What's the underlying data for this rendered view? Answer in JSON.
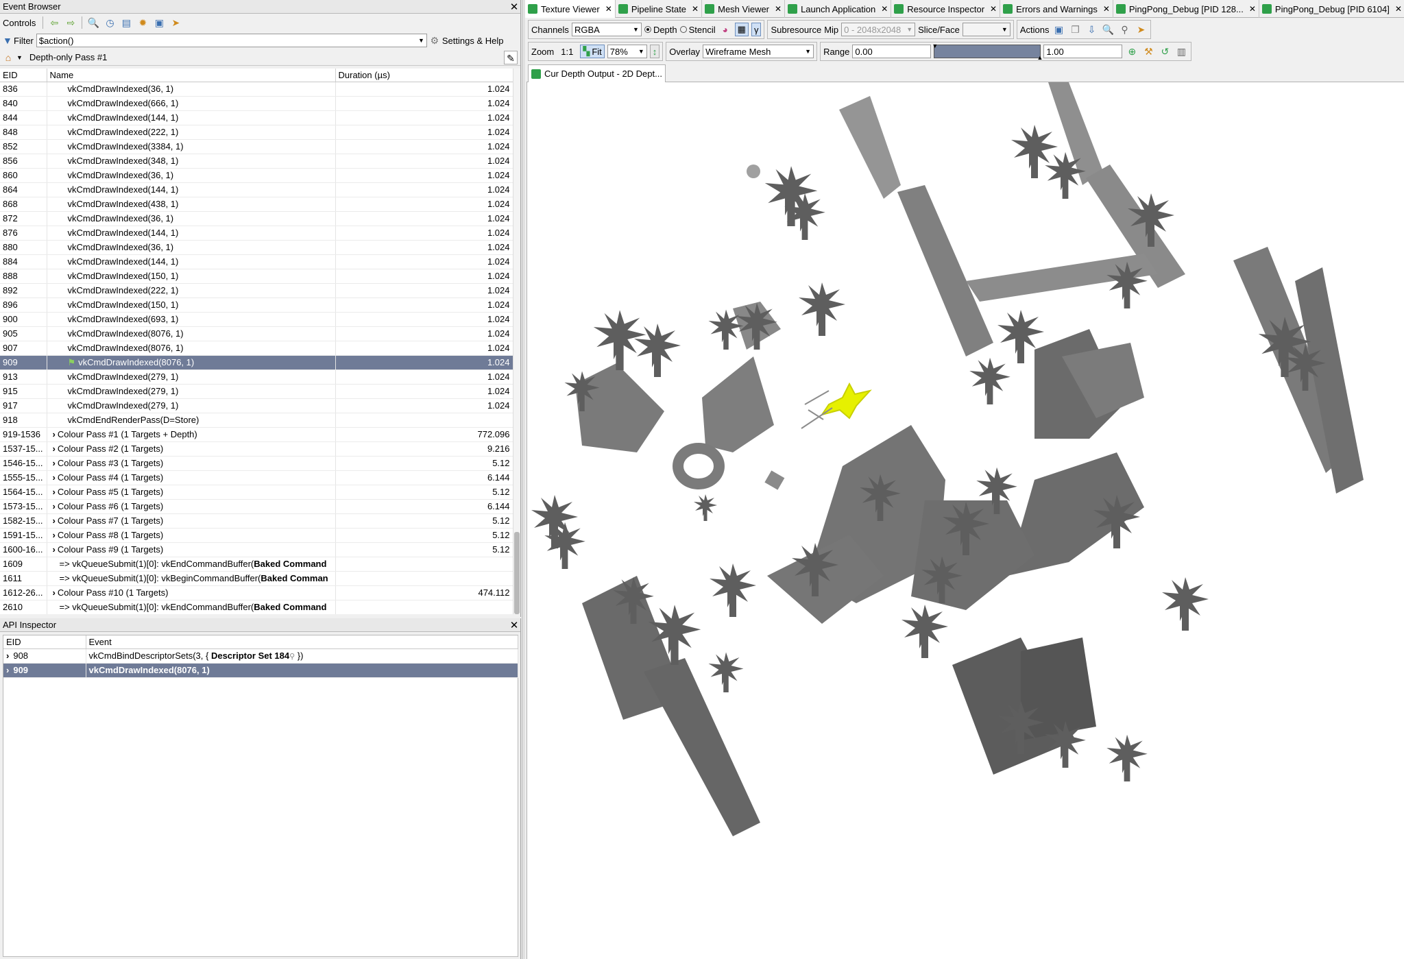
{
  "event_browser": {
    "title": "Event Browser",
    "controls_label": "Controls",
    "filter_label": "Filter",
    "filter_value": "$action()",
    "settings_label": "Settings & Help",
    "breadcrumb": "Depth-only Pass #1",
    "columns": [
      "EID",
      "Name",
      "Duration (µs)"
    ],
    "rows": [
      {
        "eid": "836",
        "name": "vkCmdDrawIndexed(36, 1)",
        "dur": "1.024",
        "indent": 2
      },
      {
        "eid": "840",
        "name": "vkCmdDrawIndexed(666, 1)",
        "dur": "1.024",
        "indent": 2
      },
      {
        "eid": "844",
        "name": "vkCmdDrawIndexed(144, 1)",
        "dur": "1.024",
        "indent": 2
      },
      {
        "eid": "848",
        "name": "vkCmdDrawIndexed(222, 1)",
        "dur": "1.024",
        "indent": 2
      },
      {
        "eid": "852",
        "name": "vkCmdDrawIndexed(3384, 1)",
        "dur": "1.024",
        "indent": 2
      },
      {
        "eid": "856",
        "name": "vkCmdDrawIndexed(348, 1)",
        "dur": "1.024",
        "indent": 2
      },
      {
        "eid": "860",
        "name": "vkCmdDrawIndexed(36, 1)",
        "dur": "1.024",
        "indent": 2
      },
      {
        "eid": "864",
        "name": "vkCmdDrawIndexed(144, 1)",
        "dur": "1.024",
        "indent": 2
      },
      {
        "eid": "868",
        "name": "vkCmdDrawIndexed(438, 1)",
        "dur": "1.024",
        "indent": 2
      },
      {
        "eid": "872",
        "name": "vkCmdDrawIndexed(36, 1)",
        "dur": "1.024",
        "indent": 2
      },
      {
        "eid": "876",
        "name": "vkCmdDrawIndexed(144, 1)",
        "dur": "1.024",
        "indent": 2
      },
      {
        "eid": "880",
        "name": "vkCmdDrawIndexed(36, 1)",
        "dur": "1.024",
        "indent": 2
      },
      {
        "eid": "884",
        "name": "vkCmdDrawIndexed(144, 1)",
        "dur": "1.024",
        "indent": 2
      },
      {
        "eid": "888",
        "name": "vkCmdDrawIndexed(150, 1)",
        "dur": "1.024",
        "indent": 2
      },
      {
        "eid": "892",
        "name": "vkCmdDrawIndexed(222, 1)",
        "dur": "1.024",
        "indent": 2
      },
      {
        "eid": "896",
        "name": "vkCmdDrawIndexed(150, 1)",
        "dur": "1.024",
        "indent": 2
      },
      {
        "eid": "900",
        "name": "vkCmdDrawIndexed(693, 1)",
        "dur": "1.024",
        "indent": 2
      },
      {
        "eid": "905",
        "name": "vkCmdDrawIndexed(8076, 1)",
        "dur": "1.024",
        "indent": 2
      },
      {
        "eid": "907",
        "name": "vkCmdDrawIndexed(8076, 1)",
        "dur": "1.024",
        "indent": 2
      },
      {
        "eid": "909",
        "name": "vkCmdDrawIndexed(8076, 1)",
        "dur": "1.024",
        "indent": 2,
        "selected": true,
        "flag": true
      },
      {
        "eid": "913",
        "name": "vkCmdDrawIndexed(279, 1)",
        "dur": "1.024",
        "indent": 2
      },
      {
        "eid": "915",
        "name": "vkCmdDrawIndexed(279, 1)",
        "dur": "1.024",
        "indent": 2
      },
      {
        "eid": "917",
        "name": "vkCmdDrawIndexed(279, 1)",
        "dur": "1.024",
        "indent": 2
      },
      {
        "eid": "918",
        "name": "vkCmdEndRenderPass(D=Store)",
        "dur": "",
        "indent": 2
      },
      {
        "eid": "919-1536",
        "name": "Colour Pass #1 (1 Targets + Depth)",
        "dur": "772.096",
        "indent": 1,
        "expand": true
      },
      {
        "eid": "1537-15...",
        "name": "Colour Pass #2 (1 Targets)",
        "dur": "9.216",
        "indent": 1,
        "expand": true
      },
      {
        "eid": "1546-15...",
        "name": "Colour Pass #3 (1 Targets)",
        "dur": "5.12",
        "indent": 1,
        "expand": true
      },
      {
        "eid": "1555-15...",
        "name": "Colour Pass #4 (1 Targets)",
        "dur": "6.144",
        "indent": 1,
        "expand": true
      },
      {
        "eid": "1564-15...",
        "name": "Colour Pass #5 (1 Targets)",
        "dur": "5.12",
        "indent": 1,
        "expand": true
      },
      {
        "eid": "1573-15...",
        "name": "Colour Pass #6 (1 Targets)",
        "dur": "6.144",
        "indent": 1,
        "expand": true
      },
      {
        "eid": "1582-15...",
        "name": "Colour Pass #7 (1 Targets)",
        "dur": "5.12",
        "indent": 1,
        "expand": true
      },
      {
        "eid": "1591-15...",
        "name": "Colour Pass #8 (1 Targets)",
        "dur": "5.12",
        "indent": 1,
        "expand": true
      },
      {
        "eid": "1600-16...",
        "name": "Colour Pass #9 (1 Targets)",
        "dur": "5.12",
        "indent": 1,
        "expand": true
      },
      {
        "eid": "1609",
        "name": "=> vkQueueSubmit(1)[0]: vkEndCommandBuffer(",
        "bold": "Baked Command",
        "dur": "",
        "indent": 1
      },
      {
        "eid": "1611",
        "name": "=> vkQueueSubmit(1)[0]: vkBeginCommandBuffer(",
        "bold": "Baked Comman",
        "dur": "",
        "indent": 1
      },
      {
        "eid": "1612-26...",
        "name": "Colour Pass #10 (1 Targets)",
        "dur": "474.112",
        "indent": 1,
        "expand": true
      },
      {
        "eid": "2610",
        "name": "=> vkQueueSubmit(1)[0]: vkEndCommandBuffer(",
        "bold": "Baked Command",
        "dur": "",
        "indent": 1
      }
    ]
  },
  "api_inspector": {
    "title": "API Inspector",
    "columns": [
      "EID",
      "Event"
    ],
    "rows": [
      {
        "eid": "908",
        "event": "vkCmdBindDescriptorSets(3, { ",
        "bold": "Descriptor Set 184",
        "tail": " })",
        "selected": false
      },
      {
        "eid": "909",
        "event": "vkCmdDrawIndexed(8076, 1)",
        "selected": true
      }
    ]
  },
  "tabs": [
    {
      "label": "Texture Viewer",
      "active": true
    },
    {
      "label": "Pipeline State"
    },
    {
      "label": "Mesh Viewer"
    },
    {
      "label": "Launch Application"
    },
    {
      "label": "Resource Inspector"
    },
    {
      "label": "Errors and Warnings"
    },
    {
      "label": "PingPong_Debug [PID 128..."
    },
    {
      "label": "PingPong_Debug [PID 6104]"
    }
  ],
  "texture_viewer": {
    "channels_label": "Channels",
    "channels_value": "RGBA",
    "depth_label": "Depth",
    "stencil_label": "Stencil",
    "gamma_label": "γ",
    "subresource_label": "Subresource",
    "mip_label": "Mip",
    "mip_value": "0 - 2048x2048",
    "slice_label": "Slice/Face",
    "actions_label": "Actions",
    "zoom_label": "Zoom",
    "zoom_1to1": "1:1",
    "fit_label": "Fit",
    "zoom_value": "78%",
    "overlay_label": "Overlay",
    "overlay_value": "Wireframe Mesh",
    "range_label": "Range",
    "range_min": "0.00",
    "range_max": "1.00",
    "subtab_label": "Cur Depth Output - 2D Dept..."
  },
  "colors": {
    "selection": "#6f7b97",
    "accent_green": "#2fa04a",
    "highlight_yellow": "#e6f000",
    "depth_gray": "#808080"
  }
}
